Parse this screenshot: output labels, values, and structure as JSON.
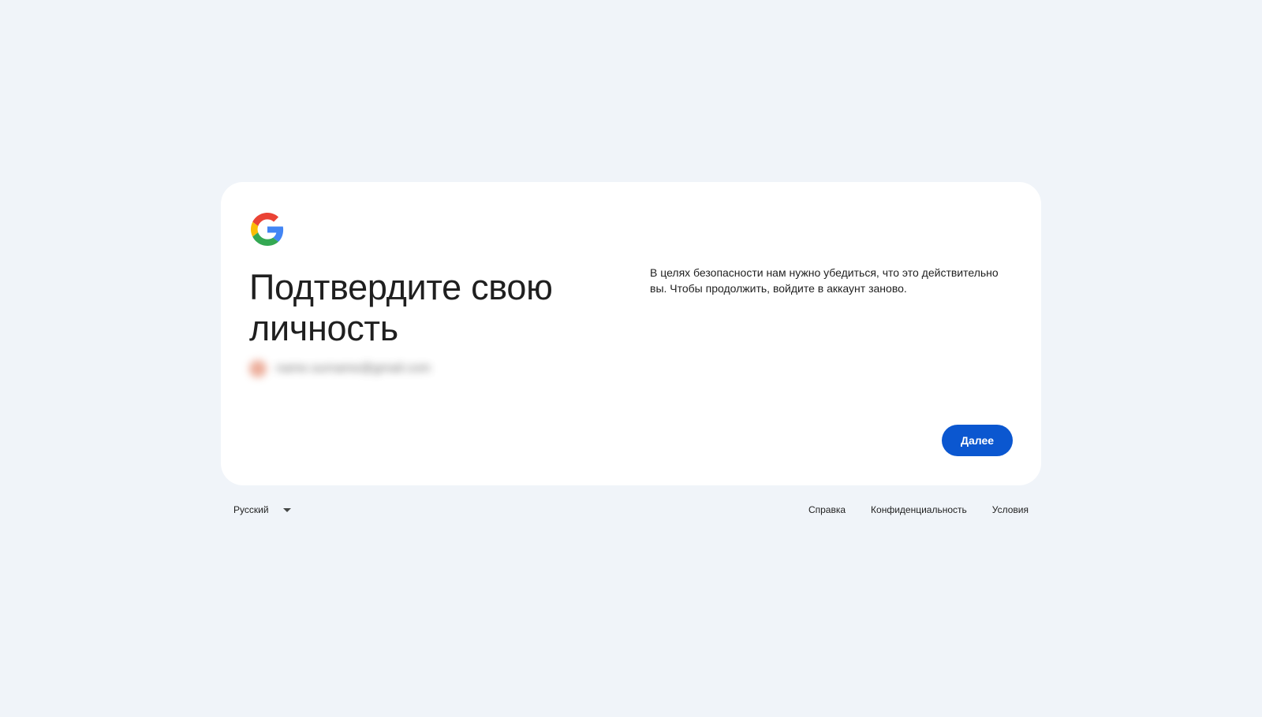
{
  "card": {
    "logo_icon": "google-g-icon",
    "title": "Подтвердите свою личность",
    "description": "В целях безопасности нам нужно убедиться, что это действительно вы. Чтобы продолжить, войдите в аккаунт заново.",
    "next_button_label": "Далее",
    "account_email_blurred": "name.surname@gmail.com"
  },
  "footer": {
    "language": "Русский",
    "links": [
      "Справка",
      "Конфиденциальность",
      "Условия"
    ]
  },
  "colors": {
    "background": "#f0f4f9",
    "card": "#ffffff",
    "primary_button": "#0b57d0",
    "text": "#1f1f1f"
  }
}
